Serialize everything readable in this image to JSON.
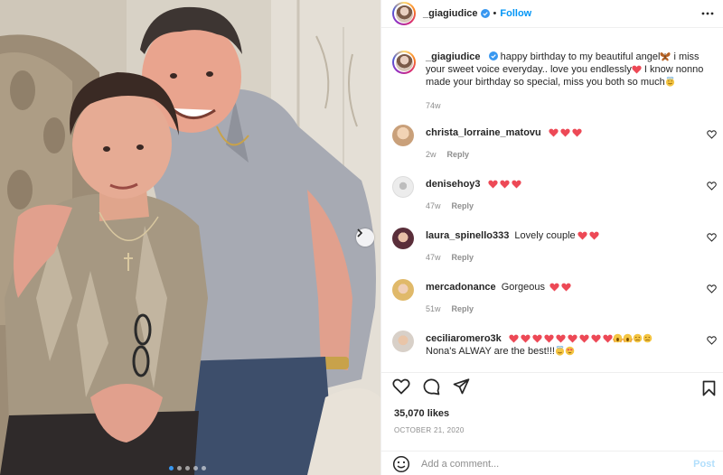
{
  "post": {
    "username": "_giagiudice",
    "follow_label": "Follow",
    "separator": "•",
    "caption_user": "_giagiudice",
    "caption_text_1": "happy birthday to my beautiful angel",
    "caption_text_2": " i miss your sweet voice everyday.. love you endlessly",
    "caption_text_3": " I know nonno made your birthday so special, miss you both so much",
    "caption_time": "74w",
    "likes": "35,070 likes",
    "date": "OCTOBER 21, 2020",
    "comment_placeholder": "Add a comment...",
    "post_label": "Post"
  },
  "comments": [
    {
      "user": "christa_lorraine_matovu",
      "text": "",
      "emojis": [
        "heart",
        "heart",
        "heart"
      ],
      "time": "2w",
      "reply": "Reply",
      "avatar_color": "#c9a07a"
    },
    {
      "user": "denisehoy3",
      "text": "",
      "emojis": [
        "heart",
        "heart",
        "heart"
      ],
      "time": "47w",
      "reply": "Reply",
      "avatar_color": "#e8e8e8"
    },
    {
      "user": "laura_spinello333",
      "text": "Lovely couple",
      "emojis": [
        "heart",
        "heart"
      ],
      "time": "47w",
      "reply": "Reply",
      "avatar_color": "#8b4a5c"
    },
    {
      "user": "mercadonance",
      "text": "Gorgeous",
      "emojis": [
        "heart",
        "heart"
      ],
      "time": "51w",
      "reply": "Reply",
      "avatar_color": "#e0b96a"
    },
    {
      "user": "ceciliaromero3k",
      "text": "Nona's ALWAY are the best!!!",
      "emojis": [
        "heart",
        "heart",
        "heart",
        "heart",
        "heart",
        "heart",
        "heart",
        "heart",
        "heart"
      ],
      "time": "",
      "reply": "",
      "avatar_color": "#d8d0c8"
    }
  ],
  "colors": {
    "accent": "#0095f6",
    "heart": "#ed4956",
    "muted": "#8e8e8e"
  },
  "carousel": {
    "active_index": 0,
    "count": 5
  }
}
